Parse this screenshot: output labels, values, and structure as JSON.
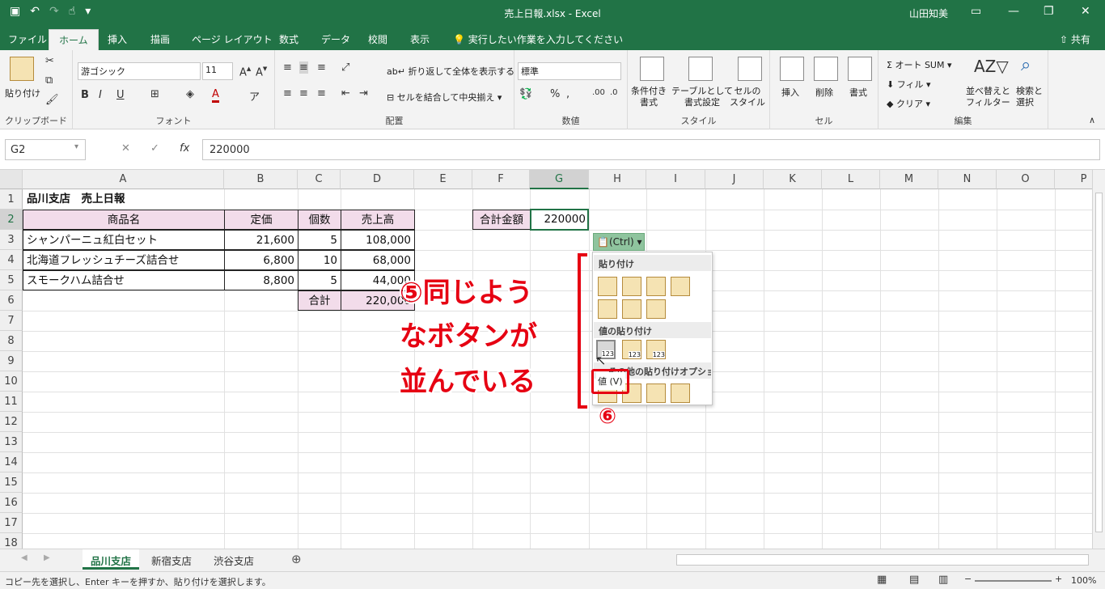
{
  "window": {
    "title": "売上日報.xlsx  -  Excel",
    "user": "山田知美",
    "share": "共有"
  },
  "tabs": [
    "ファイル",
    "ホーム",
    "挿入",
    "描画",
    "ページ レイアウト",
    "数式",
    "データ",
    "校閲",
    "表示"
  ],
  "tellme": "実行したい作業を入力してください",
  "ribbon": {
    "paste": "貼り付け",
    "clipboard": "クリップボード",
    "font_name": "游ゴシック",
    "font_size": "11",
    "font": "フォント",
    "wrap": "折り返して全体を表示する",
    "merge": "セルを結合して中央揃え",
    "alignment": "配置",
    "number_format": "標準",
    "number": "数値",
    "cond_format": "条件付き\n書式",
    "table_format": "テーブルとして\n書式設定",
    "cell_style": "セルの\nスタイル",
    "style": "スタイル",
    "insert": "挿入",
    "delete": "削除",
    "format": "書式",
    "cells": "セル",
    "autosum": "オート SUM",
    "fill": "フィル",
    "clear": "クリア",
    "sort": "並べ替えと\nフィルター",
    "find": "検索と\n選択",
    "editing": "編集"
  },
  "formula": {
    "namebox": "G2",
    "value": "220000"
  },
  "columns": [
    "A",
    "B",
    "C",
    "D",
    "E",
    "F",
    "G",
    "H",
    "I",
    "J",
    "K",
    "L",
    "M",
    "N",
    "O",
    "P"
  ],
  "rows": [
    "1",
    "2",
    "3",
    "4",
    "5",
    "6",
    "7",
    "8",
    "9",
    "10",
    "11",
    "12",
    "13",
    "14",
    "15",
    "16",
    "17",
    "18"
  ],
  "sheet": {
    "title": "品川支店　売上日報",
    "headers": [
      "商品名",
      "定価",
      "個数",
      "売上高"
    ],
    "items": [
      {
        "name": "シャンパーニュ紅白セット",
        "price": "21,600",
        "qty": "5",
        "sales": "108,000"
      },
      {
        "name": "北海道フレッシュチーズ詰合せ",
        "price": "6,800",
        "qty": "10",
        "sales": "68,000"
      },
      {
        "name": "スモークハム詰合せ",
        "price": "8,800",
        "qty": "5",
        "sales": "44,000"
      }
    ],
    "total_label": "合計",
    "total_value": "220,000",
    "sum_label": "合計金額",
    "sum_value": "220000"
  },
  "paste_menu": {
    "ctrl": "(Ctrl)",
    "section1": "貼り付け",
    "section2": "値の貼り付け",
    "section3": "その他の貼り付けオプション",
    "tooltip": "値 (V)"
  },
  "annotation": {
    "line1": "⑤同じよう",
    "line2": "なボタンが",
    "line3": "並んでいる",
    "marker": "⑥"
  },
  "sheet_tabs": [
    "品川支店",
    "新宿支店",
    "渋谷支店"
  ],
  "status": {
    "message": "コピー先を選択し、Enter キーを押すか、貼り付けを選択します。",
    "zoom": "100%"
  },
  "colors": {
    "excel_green": "#217346",
    "header_pink": "#f2dcea",
    "annotation_red": "#e60012"
  }
}
